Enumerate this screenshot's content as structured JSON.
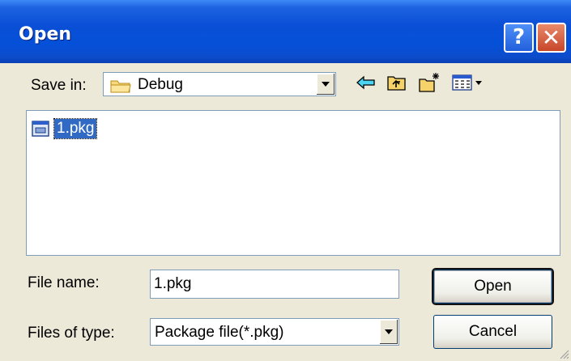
{
  "window": {
    "title": "Open",
    "help_label": "?",
    "close_label": "✕"
  },
  "toolbar": {
    "save_in_label": "Save in:",
    "location_value": "Debug",
    "icons": [
      "back-arrow-icon",
      "up-folder-icon",
      "new-folder-icon",
      "view-menu-icon"
    ]
  },
  "files": [
    {
      "name": "1.pkg",
      "selected": true
    }
  ],
  "form": {
    "file_name_label": "File name:",
    "file_name_value": "1.pkg",
    "file_type_label": "Files of type:",
    "file_type_value": "Package file(*.pkg)"
  },
  "buttons": {
    "open_label": "Open",
    "cancel_label": "Cancel"
  },
  "colors": {
    "titlebar": "#0a4fd6",
    "selection": "#316ac5",
    "face": "#ece9d8"
  }
}
